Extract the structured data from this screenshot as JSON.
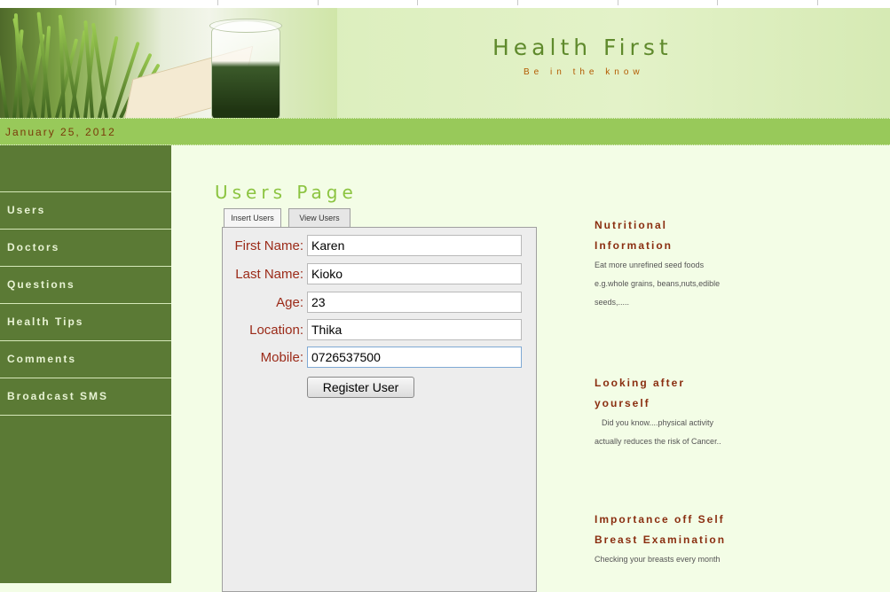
{
  "header": {
    "site_title": "Health First",
    "tagline": "Be in the know"
  },
  "date": "January 25, 2012",
  "sidebar": {
    "items": [
      {
        "label": "Users"
      },
      {
        "label": "Doctors"
      },
      {
        "label": "Questions"
      },
      {
        "label": "Health Tips"
      },
      {
        "label": "Comments"
      },
      {
        "label": "Broadcast SMS"
      }
    ]
  },
  "main": {
    "page_title": "Users Page",
    "tabs": [
      {
        "label": "Insert Users",
        "active": true
      },
      {
        "label": "View Users",
        "active": false
      }
    ],
    "form": {
      "fields": [
        {
          "label": "First Name:",
          "value": "Karen"
        },
        {
          "label": "Last Name:",
          "value": "Kioko"
        },
        {
          "label": "Age:",
          "value": "23"
        },
        {
          "label": "Location:",
          "value": "Thika"
        },
        {
          "label": "Mobile:",
          "value": "0726537500"
        }
      ],
      "submit_label": "Register User"
    }
  },
  "right_column": {
    "sections": [
      {
        "title_line1": "Nutritional",
        "title_line2": "Information",
        "lines": [
          "Eat more unrefined seed foods",
          "e.g.whole grains, beans,nuts,edible",
          "seeds,....."
        ]
      },
      {
        "title_line1": "Looking after",
        "title_line2": "yourself",
        "lines": [
          "Did you know....physical activity",
          "actually reduces the risk of Cancer.."
        ]
      },
      {
        "title_line1": "Importance off Self",
        "title_line2": "Breast Examination",
        "lines": [
          "Checking your breasts every month"
        ]
      }
    ]
  },
  "colors": {
    "sidebar_bg": "#5b7a35",
    "date_bar": "#98c95a",
    "header_bg": "#d6eab4",
    "content_bg": "#f3fde6",
    "label_red": "#9b2a18",
    "title_green": "#8cc441",
    "heading_brown": "#8a2e10"
  }
}
